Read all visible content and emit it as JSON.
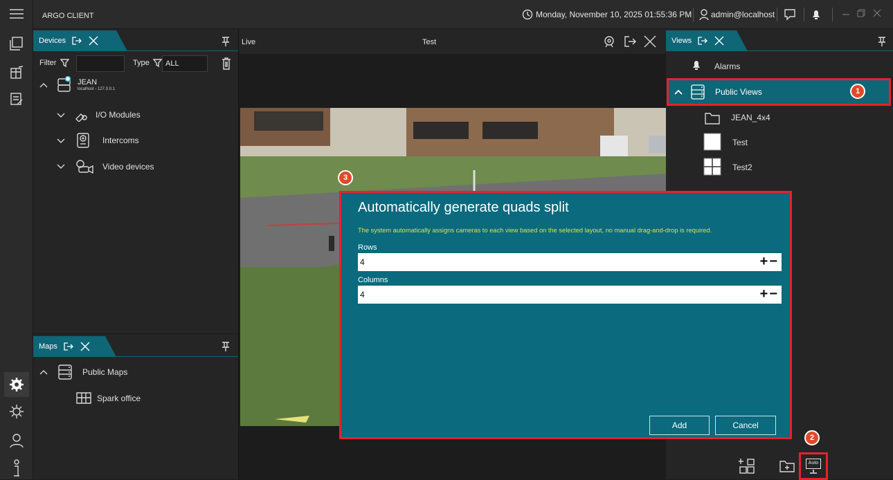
{
  "app": {
    "title": "ARGO CLIENT"
  },
  "topbar": {
    "datetime": "Monday, November 10, 2025 01:55:36 PM",
    "user": "admin@localhost"
  },
  "devices": {
    "tab_label": "Devices",
    "filter_label": "Filter",
    "type_label": "Type",
    "type_value": "ALL",
    "server_name": "JEAN",
    "server_address": "localhost - 127.0.0.1",
    "items": [
      {
        "label": "I/O Modules",
        "icon": "io-modules-icon"
      },
      {
        "label": "Intercoms",
        "icon": "intercom-icon"
      },
      {
        "label": "Video devices",
        "icon": "video-devices-icon"
      }
    ]
  },
  "maps": {
    "tab_label": "Maps",
    "group": "Public Maps",
    "item": "Spark office"
  },
  "live": {
    "label": "Live",
    "title": "Test"
  },
  "views": {
    "tab_label": "Views",
    "alarms": "Alarms",
    "public_views": "Public Views",
    "items": [
      {
        "label": "JEAN_4x4",
        "icon": "folder-icon"
      },
      {
        "label": "Test",
        "icon": "single-view-icon"
      },
      {
        "label": "Test2",
        "icon": "quad-view-icon"
      }
    ],
    "auto_label": "Auto"
  },
  "dialog": {
    "title": "Automatically generate quads split",
    "description": "The system automatically assigns cameras to each view based on the selected layout, no manual drag-and-drop is required.",
    "rows_label": "Rows",
    "rows_value": "4",
    "columns_label": "Columns",
    "columns_value": "4",
    "add_label": "Add",
    "cancel_label": "Cancel"
  },
  "annotations": {
    "one": "1",
    "two": "2",
    "three": "3"
  },
  "colors": {
    "accent": "#0e6677",
    "dialog": "#0b6a7d",
    "highlight": "#e8202c",
    "description": "#d6e64a"
  }
}
